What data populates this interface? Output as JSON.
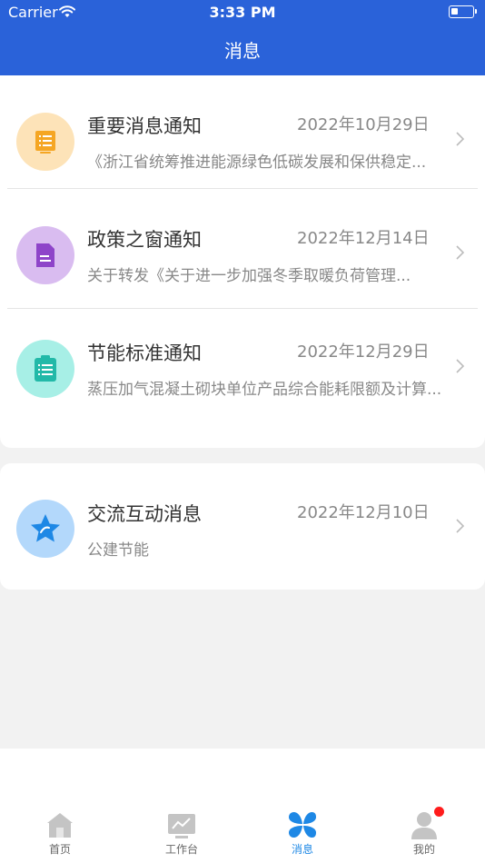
{
  "status_bar": {
    "carrier": "Carrier",
    "time": "3:33 PM"
  },
  "header": {
    "title": "消息"
  },
  "messages": [
    {
      "icon": "notice-icon",
      "title": "重要消息通知",
      "date": "2022年10月29日",
      "subtitle": "《浙江省统筹推进能源绿色低碳发展和保供稳定..."
    },
    {
      "icon": "document-icon",
      "title": "政策之窗通知",
      "date": "2022年12月14日",
      "subtitle": "关于转发《关于进一步加强冬季取暖负荷管理..."
    },
    {
      "icon": "clipboard-icon",
      "title": "节能标准通知",
      "date": "2022年12月29日",
      "subtitle": "蒸压加气混凝土砌块单位产品综合能耗限额及计算..."
    },
    {
      "icon": "star-icon",
      "title": "交流互动消息",
      "date": "2022年12月10日",
      "subtitle": "公建节能"
    }
  ],
  "tabs": [
    {
      "label": "首页",
      "icon": "home-icon"
    },
    {
      "label": "工作台",
      "icon": "workbench-icon"
    },
    {
      "label": "消息",
      "icon": "messages-icon",
      "active": true
    },
    {
      "label": "我的",
      "icon": "profile-icon",
      "badge": true
    }
  ],
  "colors": {
    "header_bg": "#2a62d9",
    "active_tab": "#1e88e5",
    "badge": "#ff1c1c"
  }
}
